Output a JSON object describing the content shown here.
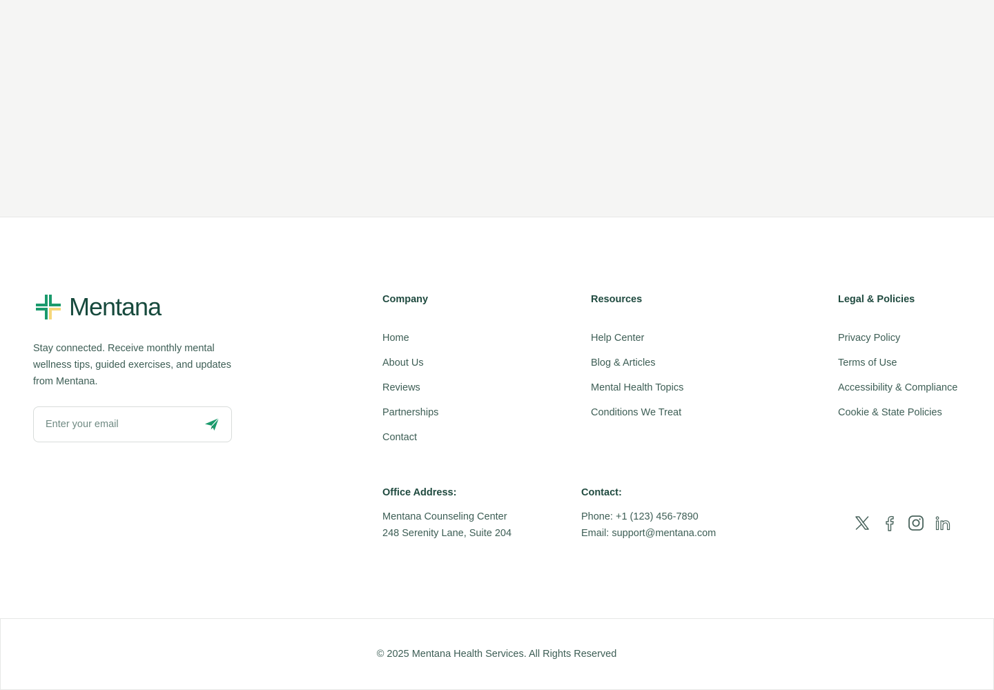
{
  "brand": {
    "name": "Mentana",
    "tagline": "Stay connected. Receive monthly mental wellness tips, guided exercises, and updates from Mentana.",
    "email_placeholder": "Enter your email",
    "colors": {
      "green": "#1a9a6c",
      "yellow": "#f6d77a",
      "dark": "#174a3d"
    }
  },
  "company": {
    "heading": "Company",
    "links": [
      "Home",
      "About Us",
      "Reviews",
      "Partnerships",
      "Contact"
    ]
  },
  "resources": {
    "heading": "Resources",
    "links": [
      "Help Center",
      "Blog & Articles",
      "Mental Health Topics",
      "Conditions We Treat"
    ]
  },
  "legal": {
    "heading": "Legal & Policies",
    "links": [
      "Privacy Policy",
      "Terms of Use",
      "Accessibility & Compliance",
      "Cookie & State Policies"
    ]
  },
  "office": {
    "heading": "Office Address:",
    "line1": "Mentana Counseling Center",
    "line2": "248 Serenity Lane, Suite 204"
  },
  "contact": {
    "heading": "Contact:",
    "phone": "Phone: +1 (123) 456-7890",
    "email": "Email: support@mentana.com"
  },
  "socials": [
    "x-icon",
    "facebook-icon",
    "instagram-icon",
    "linkedin-icon"
  ],
  "footer": {
    "copyright": "© 2025 Mentana Health Services. All Rights Reserved"
  }
}
